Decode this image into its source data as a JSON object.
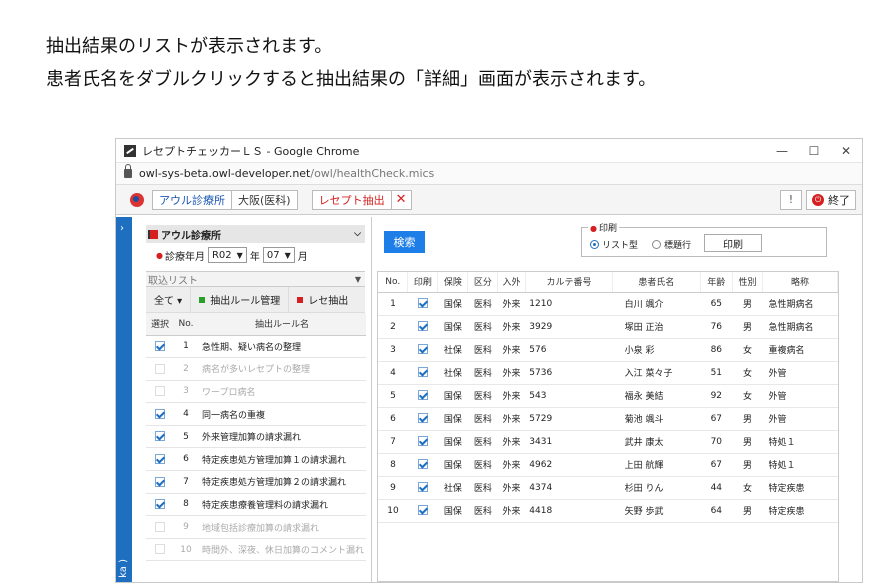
{
  "intro": {
    "line1": "抽出結果のリストが表示されます。",
    "line2": "患者氏名をダブルクリックすると抽出結果の「詳細」画面が表示されます。"
  },
  "window": {
    "title": "レセプトチェッカーＬＳ - Google Chrome",
    "url_host": "owl-sys-beta.owl-developer.net",
    "url_path": "/owl/healthCheck.mics",
    "minimize": "—",
    "maximize": "☐",
    "close": "✕"
  },
  "toolbar": {
    "clinic_label": "アウル診療所",
    "department_label": "大阪(医科)",
    "extract_label": "レセプト抽出",
    "extract_close": "✕",
    "help_label": "!",
    "exit_label": "終了",
    "exit_icon": "⏻"
  },
  "sidebar": {
    "arrow": "›",
    "vertical_text": "ka )"
  },
  "left": {
    "clinic_header": "アウル診療所",
    "date_label": "診療年月",
    "era": "R02",
    "year_unit": "年",
    "month": "07",
    "month_unit": "月",
    "list_header": "取込リスト",
    "actions": {
      "all": "全て ▾",
      "rule_manage": "抽出ルール管理",
      "rece_extract": "レセ抽出"
    },
    "columns": {
      "select": "選択",
      "no": "No.",
      "rule": "抽出ルール名"
    },
    "rules": [
      {
        "no": "1",
        "name": "急性期、疑い病名の整理",
        "checked": true
      },
      {
        "no": "2",
        "name": "病名が多いレセプトの整理",
        "checked": false
      },
      {
        "no": "3",
        "name": "ワープロ病名",
        "checked": false
      },
      {
        "no": "4",
        "name": "同一病名の重複",
        "checked": true
      },
      {
        "no": "5",
        "name": "外来管理加算の請求漏れ",
        "checked": true
      },
      {
        "no": "6",
        "name": "特定疾患処方管理加算１の請求漏れ",
        "checked": true
      },
      {
        "no": "7",
        "name": "特定疾患処方管理加算２の請求漏れ",
        "checked": true
      },
      {
        "no": "8",
        "name": "特定疾患療養管理料の請求漏れ",
        "checked": true
      },
      {
        "no": "9",
        "name": "地域包括診療加算の請求漏れ",
        "checked": false
      },
      {
        "no": "10",
        "name": "時間外、深夜、休日加算のコメント漏れ",
        "checked": false
      }
    ]
  },
  "right": {
    "search_label": "検索",
    "print_legend": "印刷",
    "print_opt_list": "リスト型",
    "print_opt_row": "標題行",
    "print_button": "印刷",
    "columns": [
      "No.",
      "印刷",
      "保険",
      "区分",
      "入外",
      "カルテ番号",
      "患者氏名",
      "年齢",
      "性別",
      "略称"
    ],
    "rows": [
      {
        "no": "1",
        "insurance": "国保",
        "section": "医科",
        "inout": "外来",
        "chart": "1210",
        "name": "白川 颯介",
        "age": "65",
        "sex": "男",
        "abbr": "急性期病名"
      },
      {
        "no": "2",
        "insurance": "国保",
        "section": "医科",
        "inout": "外来",
        "chart": "3929",
        "name": "塚田 正治",
        "age": "76",
        "sex": "男",
        "abbr": "急性期病名"
      },
      {
        "no": "3",
        "insurance": "社保",
        "section": "医科",
        "inout": "外来",
        "chart": "576",
        "name": "小泉 彩",
        "age": "86",
        "sex": "女",
        "abbr": "重複病名"
      },
      {
        "no": "4",
        "insurance": "社保",
        "section": "医科",
        "inout": "外来",
        "chart": "5736",
        "name": "入江 菜々子",
        "age": "51",
        "sex": "女",
        "abbr": "外管"
      },
      {
        "no": "5",
        "insurance": "国保",
        "section": "医科",
        "inout": "外来",
        "chart": "543",
        "name": "福永 美結",
        "age": "92",
        "sex": "女",
        "abbr": "外管"
      },
      {
        "no": "6",
        "insurance": "国保",
        "section": "医科",
        "inout": "外来",
        "chart": "5729",
        "name": "菊池 颯斗",
        "age": "67",
        "sex": "男",
        "abbr": "外管"
      },
      {
        "no": "7",
        "insurance": "国保",
        "section": "医科",
        "inout": "外来",
        "chart": "3431",
        "name": "武井 康太",
        "age": "70",
        "sex": "男",
        "abbr": "特処１"
      },
      {
        "no": "8",
        "insurance": "国保",
        "section": "医科",
        "inout": "外来",
        "chart": "4962",
        "name": "上田 航輝",
        "age": "67",
        "sex": "男",
        "abbr": "特処１"
      },
      {
        "no": "9",
        "insurance": "社保",
        "section": "医科",
        "inout": "外来",
        "chart": "4374",
        "name": "杉田 りん",
        "age": "44",
        "sex": "女",
        "abbr": "特定疾患"
      },
      {
        "no": "10",
        "insurance": "国保",
        "section": "医科",
        "inout": "外来",
        "chart": "4418",
        "name": "矢野 歩武",
        "age": "64",
        "sex": "男",
        "abbr": "特定疾患"
      }
    ]
  }
}
